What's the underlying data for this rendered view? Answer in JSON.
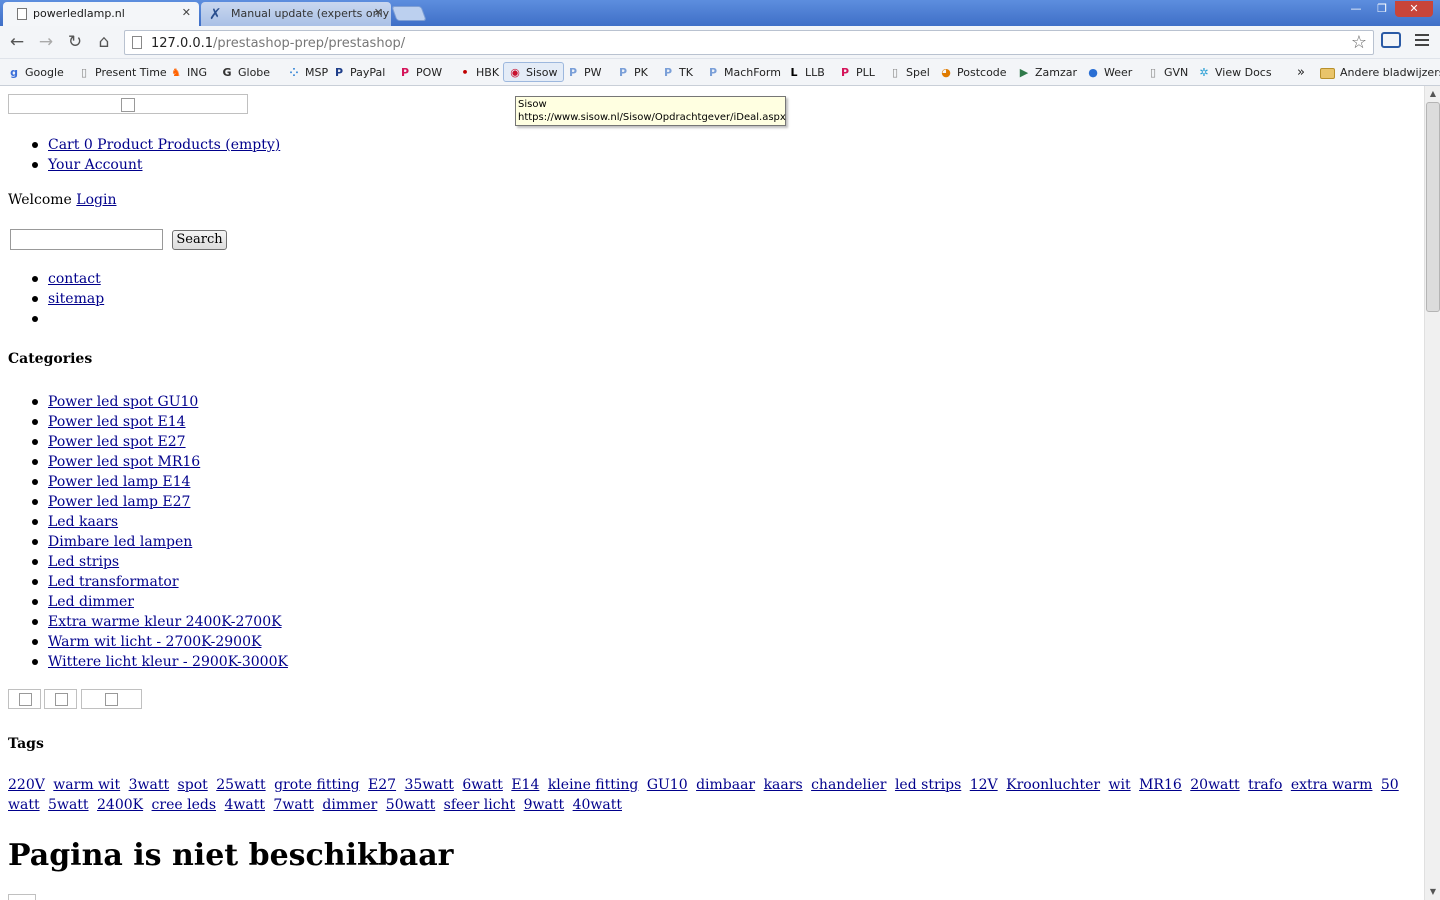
{
  "browser": {
    "tabs": [
      {
        "title": "powerledlamp.nl",
        "active": true
      },
      {
        "title": "Manual update (experts only",
        "active": false
      }
    ],
    "tab_close": "✕",
    "window_controls": {
      "minimize": "—",
      "restore": "❐",
      "close": "✕"
    },
    "url_host": "127.0.0.1",
    "url_path": "/prestashop-prep/prestashop/",
    "nav": {
      "back": "←",
      "forward": "→",
      "reload": "↻",
      "home": "⌂",
      "star": "☆"
    },
    "bookmarks": [
      {
        "label": "Google",
        "icon": "g-icon",
        "glyph": "g",
        "color": "#3b6fd9"
      },
      {
        "label": "Present Time",
        "icon": "page-icon",
        "glyph": "▯",
        "color": "#888888"
      },
      {
        "label": "ING",
        "icon": "lion-icon",
        "glyph": "♞",
        "color": "#ff6200"
      },
      {
        "label": "Globe",
        "icon": "globe-g-icon",
        "glyph": "G",
        "color": "#333333"
      },
      {
        "label": "MSP",
        "icon": "dots-icon",
        "glyph": "⁘",
        "color": "#2a7fd4"
      },
      {
        "label": "PayPal",
        "icon": "paypal-icon",
        "glyph": "P",
        "color": "#1e3e8a"
      },
      {
        "label": "POW",
        "icon": "p-pink-icon",
        "glyph": "P",
        "color": "#d4145a"
      },
      {
        "label": "HBK",
        "icon": "dot-icon",
        "glyph": "•",
        "color": "#c00000"
      },
      {
        "label": "Sisow",
        "icon": "sisow-icon",
        "glyph": "◉",
        "color": "#c8102e"
      },
      {
        "label": "PW",
        "icon": "p-blue-icon",
        "glyph": "P",
        "color": "#7a9fd8"
      },
      {
        "label": "PK",
        "icon": "p-blue-icon",
        "glyph": "P",
        "color": "#7a9fd8"
      },
      {
        "label": "TK",
        "icon": "p-blue-icon",
        "glyph": "P",
        "color": "#7a9fd8"
      },
      {
        "label": "MachForm",
        "icon": "p-blue-icon",
        "glyph": "P",
        "color": "#7a9fd8"
      },
      {
        "label": "LLB",
        "icon": "l-icon",
        "glyph": "L",
        "color": "#000000"
      },
      {
        "label": "PLL",
        "icon": "p-pink-icon",
        "glyph": "P",
        "color": "#d4145a"
      },
      {
        "label": "Spel",
        "icon": "page-icon",
        "glyph": "▯",
        "color": "#888888"
      },
      {
        "label": "Postcode",
        "icon": "postcode-icon",
        "glyph": "◕",
        "color": "#e07b00"
      },
      {
        "label": "Zamzar",
        "icon": "zamzar-icon",
        "glyph": "▶",
        "color": "#2f7a4a"
      },
      {
        "label": "Weer",
        "icon": "weer-icon",
        "glyph": "●",
        "color": "#2a6fd4"
      },
      {
        "label": "GVN",
        "icon": "page-icon",
        "glyph": "▯",
        "color": "#888888"
      },
      {
        "label": "View Docs",
        "icon": "docs-icon",
        "glyph": "✲",
        "color": "#2a9fd4"
      }
    ],
    "bookmarks_overflow": "»",
    "other_bookmarks": "Andere bladwijzers",
    "tooltip": {
      "title": "Sisow",
      "url": "https://www.sisow.nl/Sisow/Opdrachtgever/iDeal.aspx"
    }
  },
  "page": {
    "header_links": [
      "Cart 0 Product Products (empty)",
      "Your Account"
    ],
    "welcome_text": "Welcome",
    "login_link": "Login",
    "search_button": "Search",
    "utility_links": [
      "contact",
      "sitemap",
      ""
    ],
    "categories_heading": "Categories",
    "categories": [
      "Power led spot GU10",
      "Power led spot E14",
      "Power led spot E27",
      "Power led spot MR16",
      "Power led lamp E14",
      "Power led lamp E27",
      "Led kaars",
      "Dimbare led lampen",
      "Led strips",
      "Led transformator",
      "Led dimmer",
      "Extra warme kleur 2400K-2700K",
      "Warm wit licht - 2700K-2900K",
      "Wittere licht kleur - 2900K-3000K"
    ],
    "tags_heading": "Tags",
    "tags": [
      "220V",
      "warm wit",
      "3watt",
      "spot",
      "25watt",
      "grote fitting",
      "E27",
      "35watt",
      "6watt",
      "E14",
      "kleine fitting",
      "GU10",
      "dimbaar",
      "kaars",
      "chandelier",
      "led strips",
      "12V",
      "Kroonluchter",
      "wit",
      "MR16",
      "20watt",
      "trafo",
      "extra warm",
      "50 watt",
      "5watt",
      "2400K",
      "cree leds",
      "4watt",
      "7watt",
      "dimmer",
      "50watt",
      "sfeer licht",
      "9watt",
      "40watt"
    ],
    "main_heading": "Pagina is niet beschikbaar"
  },
  "scrollbar": {
    "up": "▲",
    "down": "▼"
  }
}
